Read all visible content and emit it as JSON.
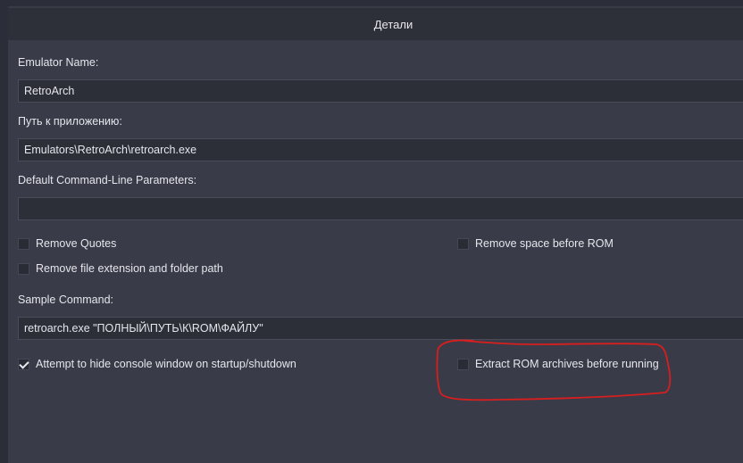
{
  "header": {
    "title": "Детали"
  },
  "form": {
    "emulator_name_label": "Emulator Name:",
    "emulator_name_value": "RetroArch",
    "app_path_label": "Путь к приложению:",
    "app_path_value": "Emulators\\RetroArch\\retroarch.exe",
    "params_label": "Default Command-Line Parameters:",
    "params_value": "",
    "sample_label": "Sample Command:",
    "sample_value": "retroarch.exe \"ПОЛНЫЙ\\ПУТЬ\\К\\ROM\\ФАЙЛУ\""
  },
  "checkboxes": {
    "remove_quotes": {
      "label": "Remove Quotes",
      "checked": false
    },
    "remove_space": {
      "label": "Remove space before ROM",
      "checked": false
    },
    "remove_ext": {
      "label": "Remove file extension and folder path",
      "checked": false
    },
    "hide_console": {
      "label": "Attempt to hide console window on startup/shutdown",
      "checked": true
    },
    "extract_rom": {
      "label": "Extract ROM archives before running",
      "checked": false
    }
  },
  "colors": {
    "annotation": "#d81e1e",
    "panel": "#393b48",
    "background": "#2b2d38"
  }
}
